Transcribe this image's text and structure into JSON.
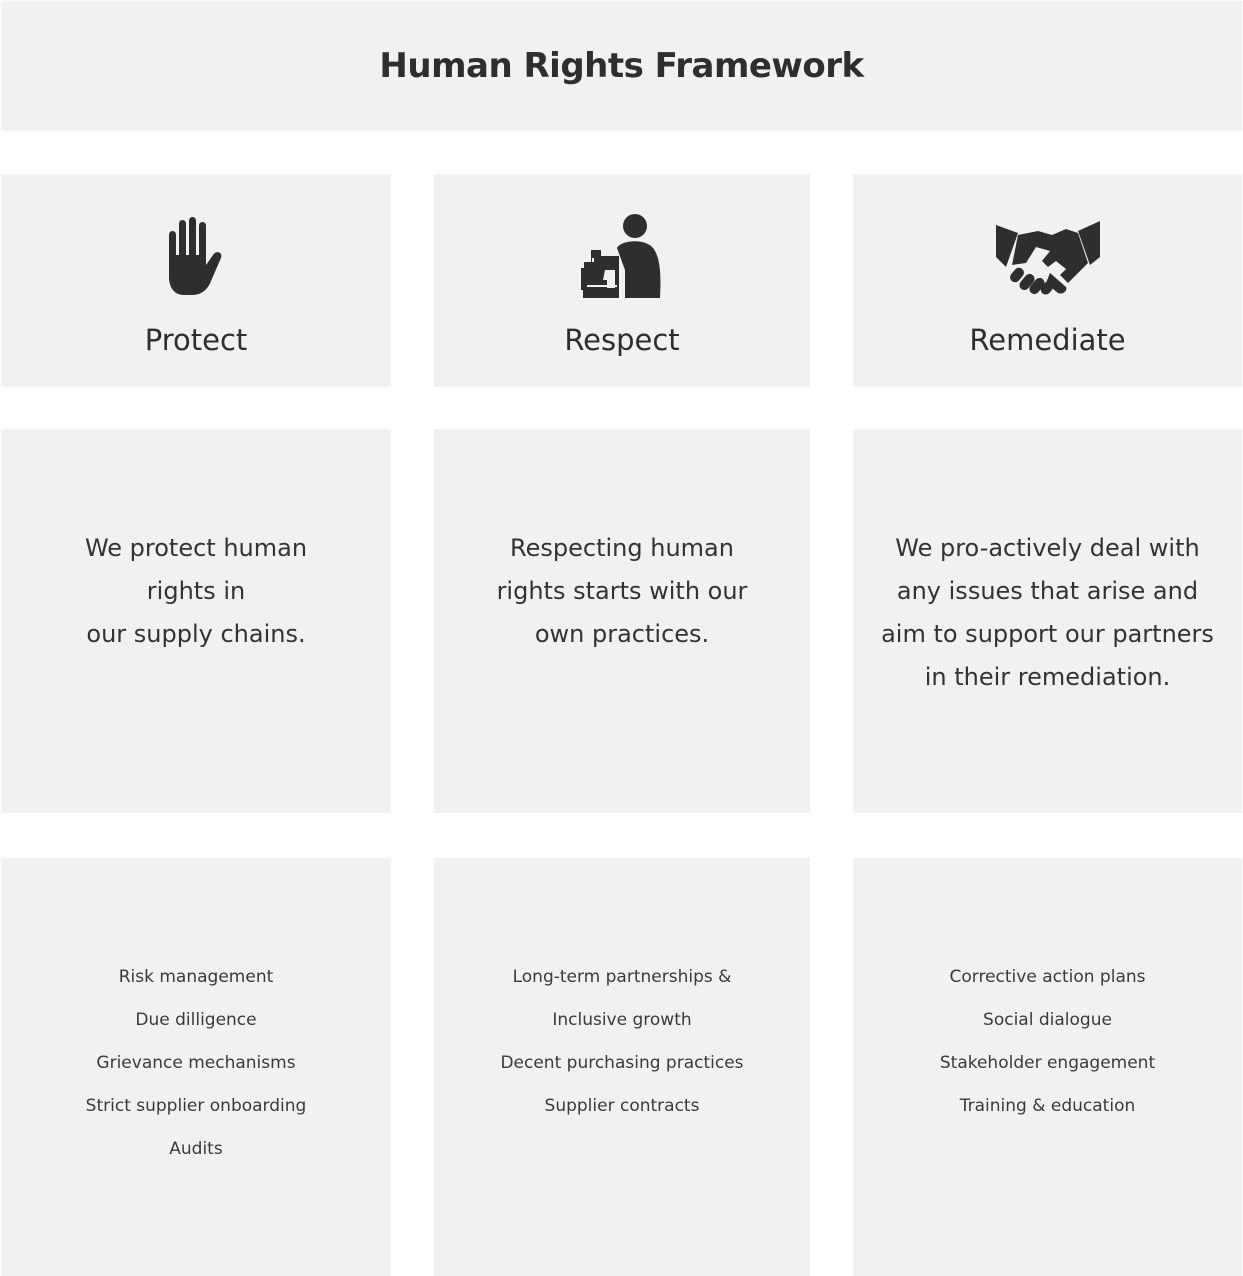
{
  "header": {
    "title": "Human Rights Framework"
  },
  "pillars": [
    {
      "title": "Protect",
      "icon": "raised-hand-icon",
      "description_lines": [
        "We protect human",
        "rights in",
        "our supply chains."
      ],
      "items": [
        "Risk management",
        "Due dilligence",
        "Grievance mechanisms",
        "Strict supplier onboarding",
        "Audits"
      ]
    },
    {
      "title": "Respect",
      "icon": "sewing-machine-worker-icon",
      "description_lines": [
        "Respecting human",
        "rights starts with our",
        "own practices."
      ],
      "items": [
        "Long-term partnerships &",
        "Inclusive growth",
        "Decent purchasing practices",
        "Supplier contracts"
      ]
    },
    {
      "title": "Remediate",
      "icon": "handshake-icon",
      "description_lines": [
        "We pro-actively deal with",
        "any issues that arise and",
        "aim to support our partners",
        "in their remediation."
      ],
      "items": [
        "Corrective action plans",
        "Social dialogue",
        "Stakeholder engagement",
        "Training & education"
      ]
    }
  ],
  "colors": {
    "panel": "#f1f1f1",
    "icon": "#2e2e2e",
    "text": "#333333"
  }
}
